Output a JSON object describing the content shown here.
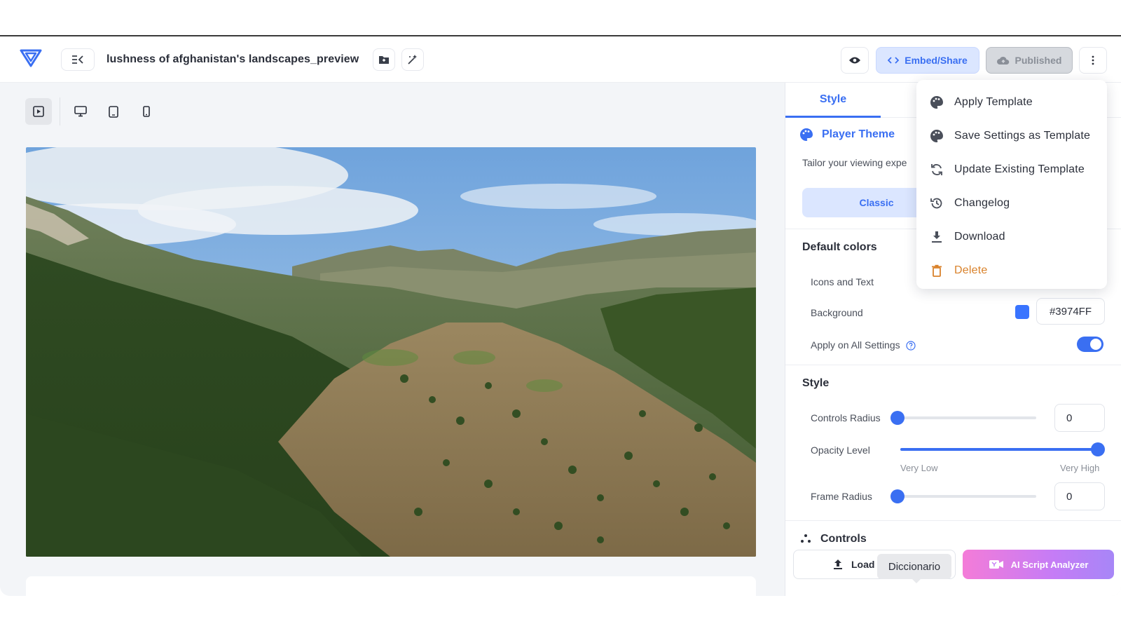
{
  "header": {
    "title": "lushness of afghanistan's landscapes_preview",
    "embed_label": "Embed/Share",
    "published_label": "Published",
    "icons": [
      "logo-icon",
      "collapse-icon",
      "folder-icon",
      "magic-icon",
      "eye-icon",
      "code-icon",
      "cloud-icon",
      "more-vertical-icon"
    ]
  },
  "device_bar": {
    "icons": [
      "play-square-icon",
      "desktop-icon",
      "tablet-icon",
      "mobile-icon"
    ],
    "active": "play-square-icon"
  },
  "panel": {
    "tab_style": "Style",
    "theme": {
      "title": "Player Theme",
      "description": "Tailor your viewing expe",
      "classic_label": "Classic"
    },
    "default_colors": {
      "title": "Default colors",
      "icons_text_label": "Icons and Text",
      "background_label": "Background",
      "background_hex": "#3974FF",
      "apply_all_label": "Apply on All Settings",
      "apply_all_on": true
    },
    "style": {
      "title": "Style",
      "controls_radius_label": "Controls Radius",
      "controls_radius_value": "0",
      "opacity_label": "Opacity Level",
      "opacity_level": 1.0,
      "opacity_min_label": "Very Low",
      "opacity_max_label": "Very High",
      "frame_radius_label": "Frame Radius",
      "frame_radius_value": "0"
    },
    "controls_title": "Controls"
  },
  "actions": {
    "load_label": "Load",
    "tooltip": "Diccionario",
    "ai_label": "AI Script Analyzer"
  },
  "menu": {
    "items": [
      {
        "label": "Apply Template",
        "icon": "palette-icon"
      },
      {
        "label": "Save Settings as Template",
        "icon": "palette-icon"
      },
      {
        "label": "Update Existing Template",
        "icon": "refresh-icon"
      },
      {
        "label": "Changelog",
        "icon": "history-icon"
      },
      {
        "label": "Download",
        "icon": "download-icon"
      },
      {
        "label": "Delete",
        "icon": "trash-icon"
      }
    ]
  },
  "colors": {
    "accent": "#3a6ff2",
    "delete": "#d9822b",
    "background_swatch": "#3974FF"
  }
}
